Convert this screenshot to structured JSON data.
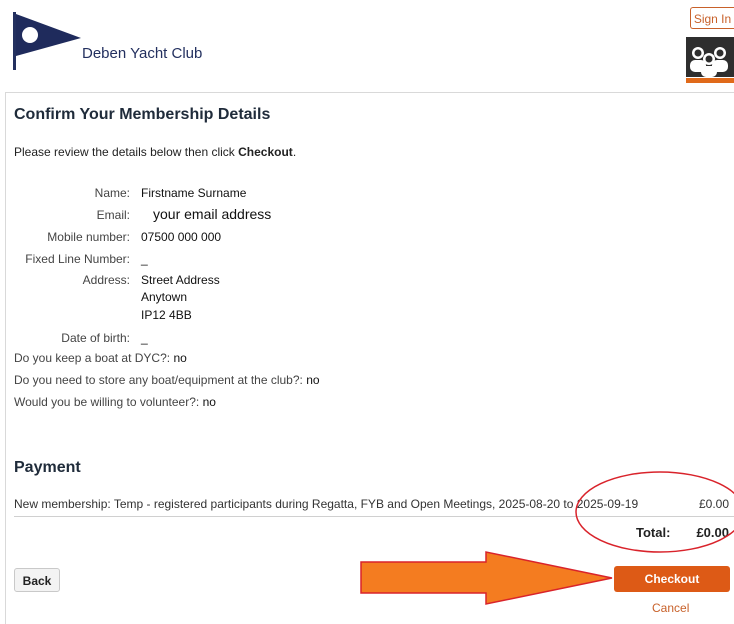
{
  "header": {
    "club_name": "Deben Yacht Club",
    "sign_in_label": "Sign In"
  },
  "page": {
    "title": "Confirm Your Membership Details",
    "intro_prefix": "Please review the details below then click ",
    "intro_emphasis": "Checkout",
    "intro_suffix": "."
  },
  "details": {
    "name_label": "Name:",
    "name_value": "Firstname Surname",
    "email_label": "Email:",
    "email_value": "your email address",
    "mobile_label": "Mobile number:",
    "mobile_value": "07500 000 000",
    "fixed_label": "Fixed Line Number:",
    "fixed_value": "_",
    "address_label": "Address:",
    "address_line1": "Street Address",
    "address_line2": "Anytown",
    "address_line3": "IP12 4BB",
    "dob_label": "Date of birth:",
    "dob_value": "_"
  },
  "questions": [
    {
      "label": "Do you keep a boat at DYC?:",
      "value": "no"
    },
    {
      "label": "Do you need to store any boat/equipment at the club?:",
      "value": "no"
    },
    {
      "label": "Would you be willing to volunteer?:",
      "value": "no"
    }
  ],
  "payment": {
    "title": "Payment",
    "item_description": "New membership: Temp - registered participants during Regatta, FYB and Open Meetings, 2025-08-20 to 2025-09-19",
    "item_amount": "£0.00",
    "total_label": "Total:",
    "total_amount": "£0.00"
  },
  "actions": {
    "back_label": "Back",
    "checkout_label": "Checkout",
    "cancel_label": "Cancel"
  },
  "colors": {
    "accent": "#dd5a16",
    "annotation_red": "#d9232b",
    "arrow_fill": "#f47c20",
    "brand_navy": "#23305f"
  }
}
